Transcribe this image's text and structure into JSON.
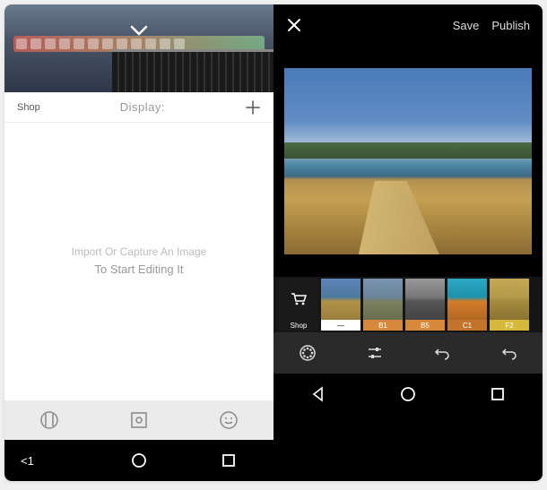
{
  "left": {
    "shop_link": "Shop",
    "display_title": "Display:",
    "add_label": "+",
    "empty_line1": "Import Or Capture An Image",
    "empty_line2": "To Start Editing It",
    "status_left": "<1"
  },
  "right": {
    "close_label": "✕",
    "save_label": "Save",
    "publish_label": "Publish",
    "filters": {
      "shop_label": "Shop",
      "original_label": "—",
      "b1_label": "B1",
      "b5_label": "B5",
      "c1_label": "C1",
      "f2_label": "F2"
    }
  },
  "icons": {
    "chevron_down": "chevron-down-icon",
    "add": "plus-icon",
    "column": "column-icon",
    "square": "square-focus-icon",
    "smiley": "smiley-icon",
    "close": "close-icon",
    "cart": "shopping-cart-icon",
    "gear": "gear-icon",
    "sliders": "sliders-icon",
    "undo": "undo-icon",
    "redo": "redo-icon",
    "nav_back": "nav-back-icon",
    "nav_home": "nav-home-icon",
    "nav_recent": "nav-recent-icon"
  },
  "colors": {
    "accent_orange": "#d6893a",
    "accent_yellow": "#d6b83a",
    "panel_dark": "#000000",
    "panel_grey": "#2a2a2a"
  }
}
